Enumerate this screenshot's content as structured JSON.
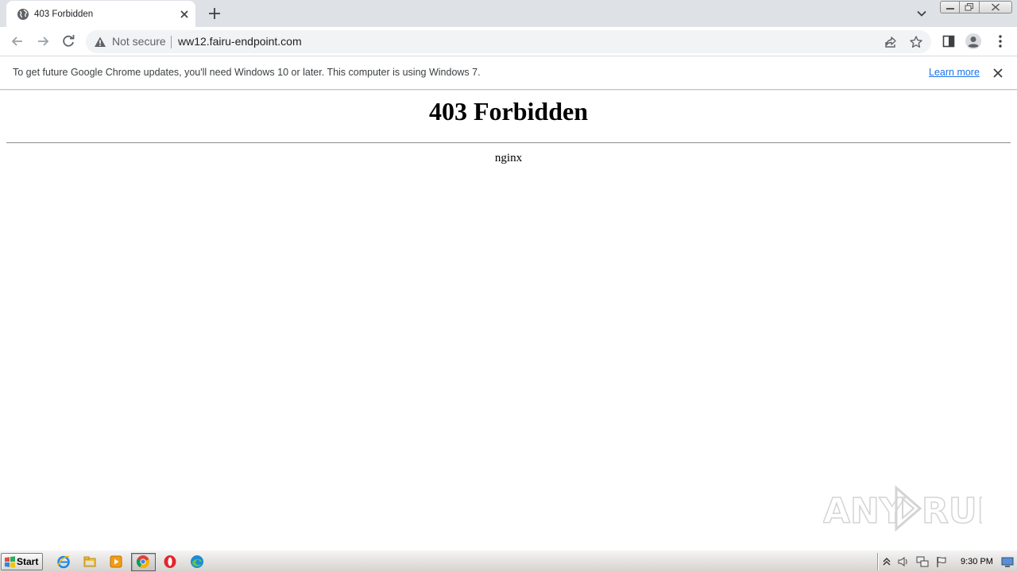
{
  "tab": {
    "title": "403 Forbidden"
  },
  "omnibox": {
    "security_label": "Not secure",
    "url": "ww12.fairu-endpoint.com"
  },
  "infobar": {
    "message": "To get future Google Chrome updates, you'll need Windows 10 or later. This computer is using Windows 7.",
    "link_label": "Learn more"
  },
  "page": {
    "heading": "403 Forbidden",
    "server": "nginx"
  },
  "watermark": {
    "text_left": "ANY",
    "text_right": "RUN"
  },
  "taskbar": {
    "start_label": "Start",
    "clock": "9:30 PM",
    "pinned_icons": [
      "internet-explorer-icon",
      "file-explorer-icon",
      "media-player-icon",
      "chrome-icon",
      "opera-icon",
      "edge-icon"
    ]
  },
  "colors": {
    "tabstrip_bg": "#dee1e6",
    "omnibox_bg": "#f1f3f4",
    "link": "#1a73e8",
    "taskbar_bg": "#d6d3ce"
  }
}
